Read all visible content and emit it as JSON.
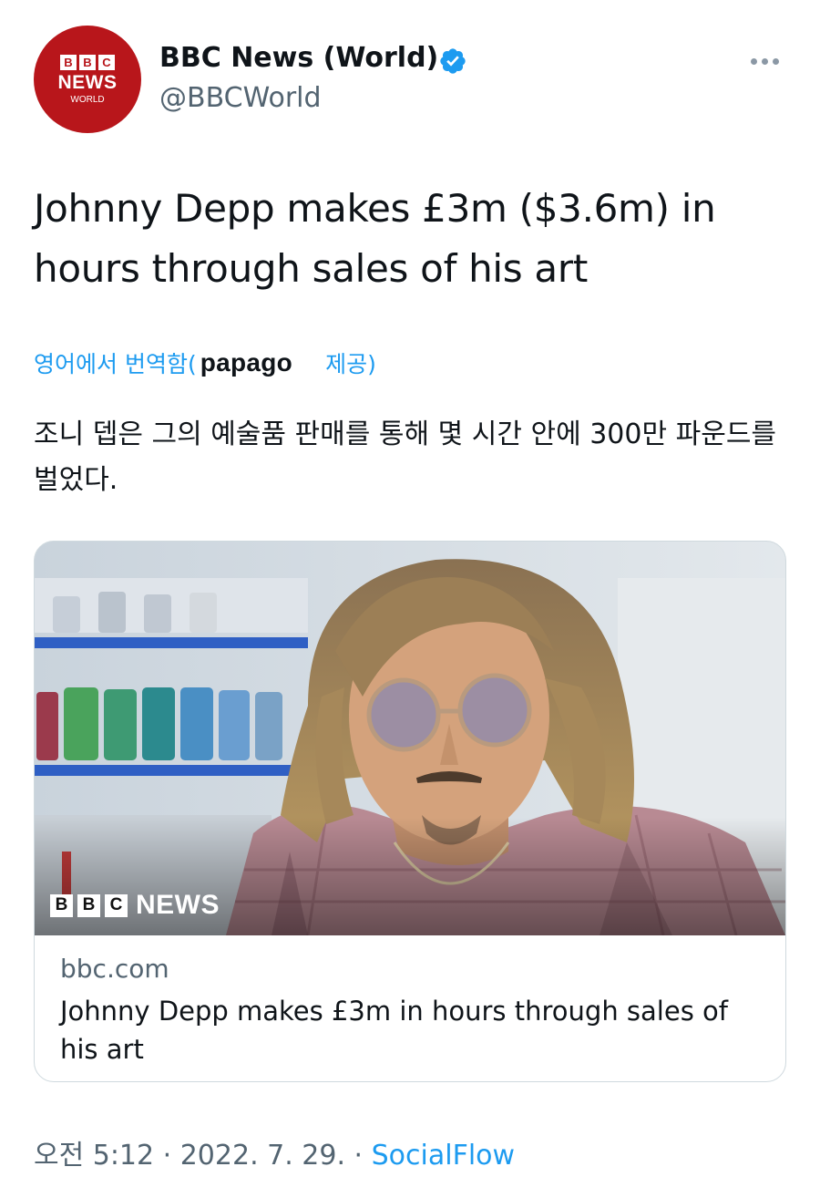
{
  "account": {
    "avatar": {
      "blocks": [
        "B",
        "B",
        "C"
      ],
      "news": "NEWS",
      "world": "WORLD"
    },
    "display_name": "BBC News (World)",
    "handle": "@BBCWorld",
    "verified": true
  },
  "tweet": {
    "text": "Johnny Depp makes £3m ($3.6m) in hours through sales of his art",
    "translation": {
      "prefix": "영어에서 번역함(",
      "provider": "papago",
      "suffix": "제공)",
      "text": "조니 뎁은 그의 예술품 판매를 통해 몇 시간 안에 300만 파운드를 벌었다."
    }
  },
  "card": {
    "image_overlay": {
      "blocks": [
        "B",
        "B",
        "C"
      ],
      "label": "NEWS"
    },
    "domain": "bbc.com",
    "title": "Johnny Depp makes £3m in hours through sales of his art"
  },
  "footer": {
    "time": "오전 5:12",
    "sep1": " · ",
    "date": "2022. 7. 29.",
    "sep2": " · ",
    "source": "SocialFlow"
  },
  "colors": {
    "accent": "#1d9bf0",
    "secondary_text": "#536471",
    "bbc_red": "#b8161b"
  },
  "icons": [
    "verified-badge-icon",
    "more-options-icon"
  ]
}
